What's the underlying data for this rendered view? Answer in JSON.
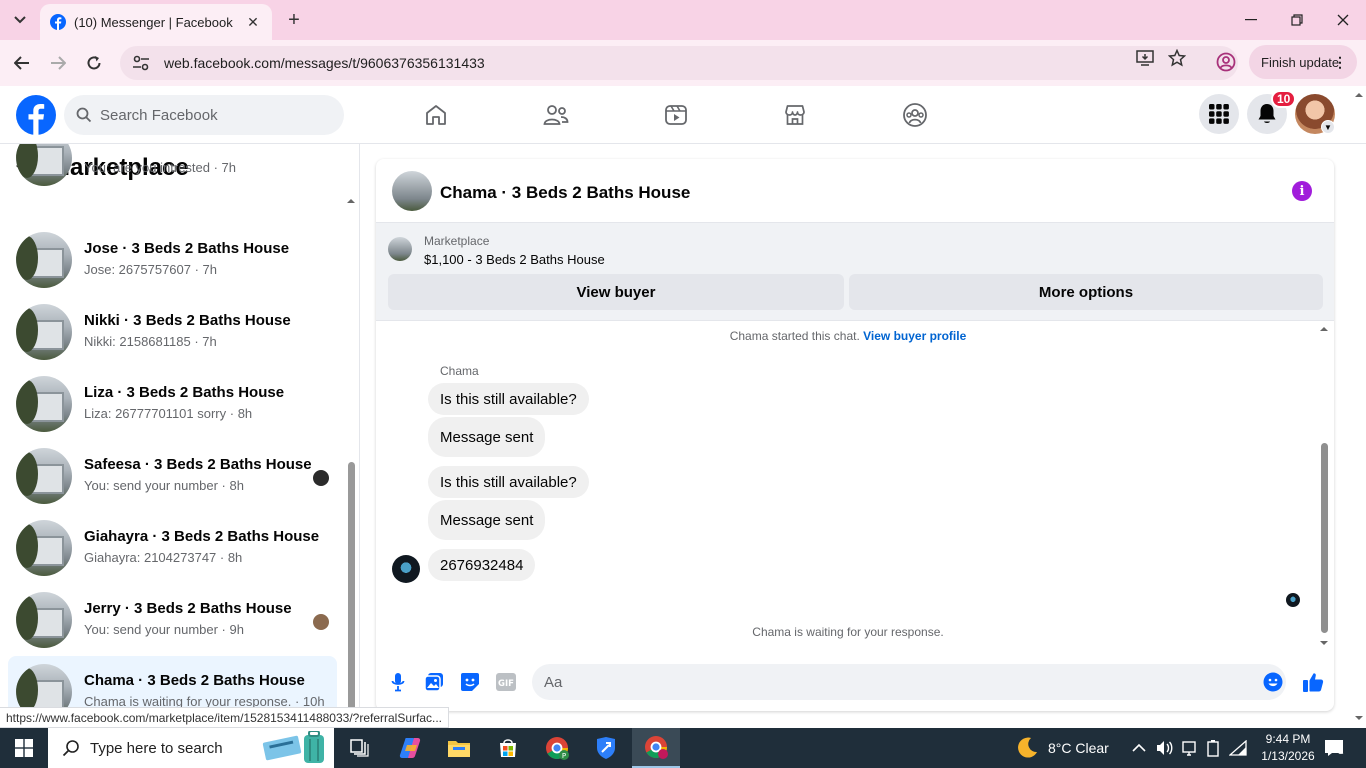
{
  "browser": {
    "tab_title": "(10) Messenger | Facebook",
    "url": "web.facebook.com/messages/t/9606376356131433",
    "finish_update": "Finish update"
  },
  "fb_header": {
    "search_placeholder": "Search Facebook",
    "notification_count": "10"
  },
  "left_panel": {
    "title": "Marketplace",
    "conversations": [
      {
        "name": "",
        "sub": "You: are you intrested · 7h"
      },
      {
        "name": "Jose · 3 Beds 2 Baths House",
        "sub": "Jose: 2675757607 · 7h"
      },
      {
        "name": "Nikki · 3 Beds 2 Baths House",
        "sub": "Nikki: 2158681185 · 7h"
      },
      {
        "name": "Liza · 3 Beds 2 Baths House",
        "sub": "Liza: 26777701101 sorry · 8h"
      },
      {
        "name": "Safeesa · 3 Beds 2 Baths House",
        "sub": "You: send your number · 8h"
      },
      {
        "name": "Giahayra · 3 Beds 2 Baths House",
        "sub": "Giahayra: 2104273747 · 8h"
      },
      {
        "name": "Jerry · 3 Beds 2 Baths House",
        "sub": "You: send your number · 9h"
      },
      {
        "name": "Chama · 3 Beds 2 Baths House",
        "sub": "Chama is waiting for your response. · 10h"
      }
    ]
  },
  "status_url": "https://www.facebook.com/marketplace/item/1528153411488033/?referralSurfac...",
  "chat": {
    "title": "Chama · 3 Beds 2 Baths House",
    "marketplace_label": "Marketplace",
    "listing": "$1,100 - 3 Beds 2 Baths House",
    "view_buyer": "View buyer",
    "more_options": "More options",
    "started_text": "Chama started this chat.",
    "view_buyer_profile": "View buyer profile",
    "sender_name": "Chama",
    "messages": [
      "Is this still available?",
      "Message sent",
      "Is this still available?",
      "Message sent",
      "2676932484"
    ],
    "waiting_text": "Chama is waiting for your response.",
    "composer_placeholder": "Aa"
  },
  "taskbar": {
    "search_placeholder": "Type here to search",
    "weather": "8°C  Clear",
    "time": "9:44 PM",
    "date": "1/13/2026",
    "notif_count": "1"
  },
  "colors": {
    "fb_blue": "#0866ff",
    "accent_purple": "#a11ddb",
    "tab_bar": "#f8d3e6"
  }
}
